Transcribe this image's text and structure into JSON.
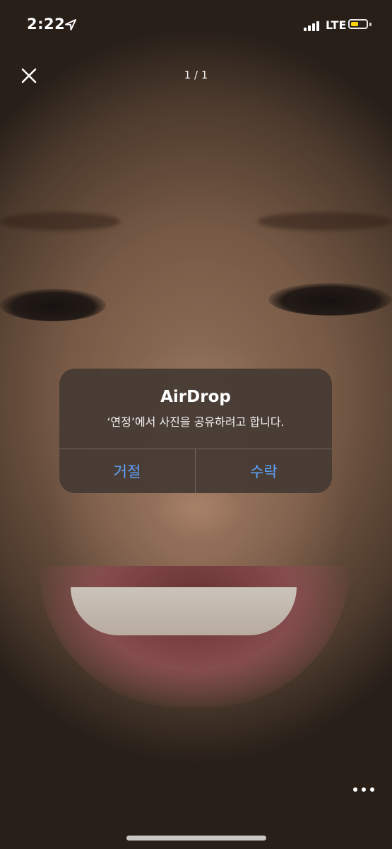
{
  "status_bar": {
    "time": "2:22",
    "network": "LTE",
    "signal_bars": 4,
    "battery_level": 0.5,
    "battery_color": "#ffd60a",
    "icons": [
      "location-arrow-icon",
      "cellular-signal-icon",
      "battery-icon"
    ]
  },
  "viewer": {
    "page_counter": "1 / 1",
    "close_icon": "close-icon",
    "more_icon": "more-horizontal-icon"
  },
  "alert": {
    "title": "AirDrop",
    "message": "‘연정’에서 사진을 공유하려고 합니다.",
    "decline_label": "거절",
    "accept_label": "수락",
    "button_color": "#5ea4ff"
  }
}
